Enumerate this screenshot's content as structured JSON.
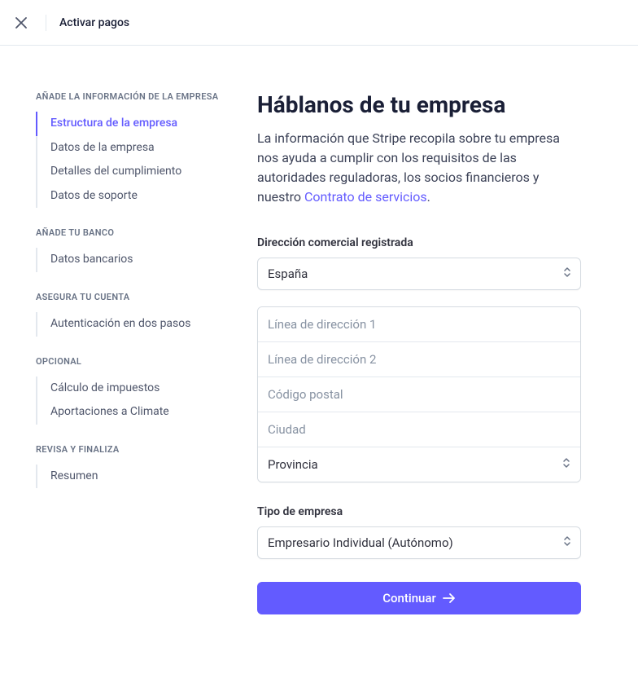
{
  "header": {
    "title": "Activar pagos"
  },
  "sidebar": {
    "sections": [
      {
        "title": "AÑADE LA INFORMACIÓN DE LA EMPRESA",
        "items": [
          {
            "label": "Estructura de la empresa",
            "active": true
          },
          {
            "label": "Datos de la empresa",
            "active": false
          },
          {
            "label": "Detalles del cumplimiento",
            "active": false
          },
          {
            "label": "Datos de soporte",
            "active": false
          }
        ]
      },
      {
        "title": "AÑADE TU BANCO",
        "items": [
          {
            "label": "Datos bancarios",
            "active": false
          }
        ]
      },
      {
        "title": "ASEGURA TU CUENTA",
        "items": [
          {
            "label": "Autenticación en dos pasos",
            "active": false
          }
        ]
      },
      {
        "title": "OPCIONAL",
        "items": [
          {
            "label": "Cálculo de impuestos",
            "active": false
          },
          {
            "label": "Aportaciones a Climate",
            "active": false
          }
        ]
      },
      {
        "title": "REVISA Y FINALIZA",
        "items": [
          {
            "label": "Resumen",
            "active": false
          }
        ]
      }
    ]
  },
  "main": {
    "title": "Háblanos de tu empresa",
    "description_pre": "La información que Stripe recopila sobre tu empresa nos ayuda a cumplir con los requisitos de las autoridades reguladoras, los socios financieros y nuestro ",
    "tos_link_label": "Contrato de servicios",
    "description_post": ".",
    "address_section_label": "Dirección comercial registrada",
    "country_selected": "España",
    "address1_placeholder": "Línea de dirección 1",
    "address2_placeholder": "Línea de dirección 2",
    "postal_placeholder": "Código postal",
    "city_placeholder": "Ciudad",
    "province_selected": "Provincia",
    "business_type_label": "Tipo de empresa",
    "business_type_selected": "Empresario Individual (Autónomo)",
    "continue_label": "Continuar"
  }
}
